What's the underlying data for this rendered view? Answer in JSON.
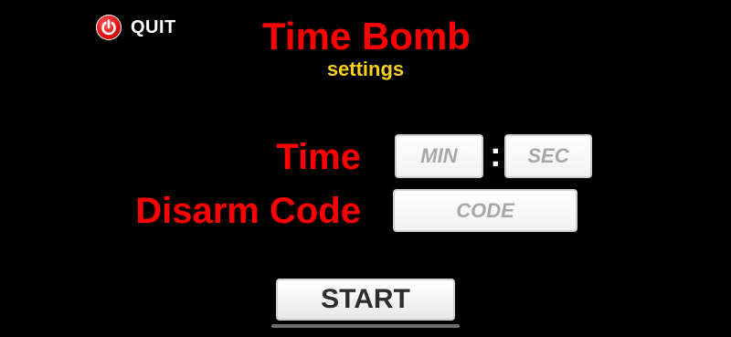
{
  "quit": {
    "label": "QUIT",
    "icon": "power-icon",
    "color": "#e01010"
  },
  "header": {
    "title": "Time Bomb",
    "subtitle": "settings"
  },
  "form": {
    "time_label": "Time",
    "min_placeholder": "MIN",
    "separator": ":",
    "sec_placeholder": "SEC",
    "code_label": "Disarm Code",
    "code_placeholder": "CODE"
  },
  "start_label": "START",
  "colors": {
    "title": "#ff0000",
    "subtitle": "#f7d117",
    "background": "#000000"
  }
}
